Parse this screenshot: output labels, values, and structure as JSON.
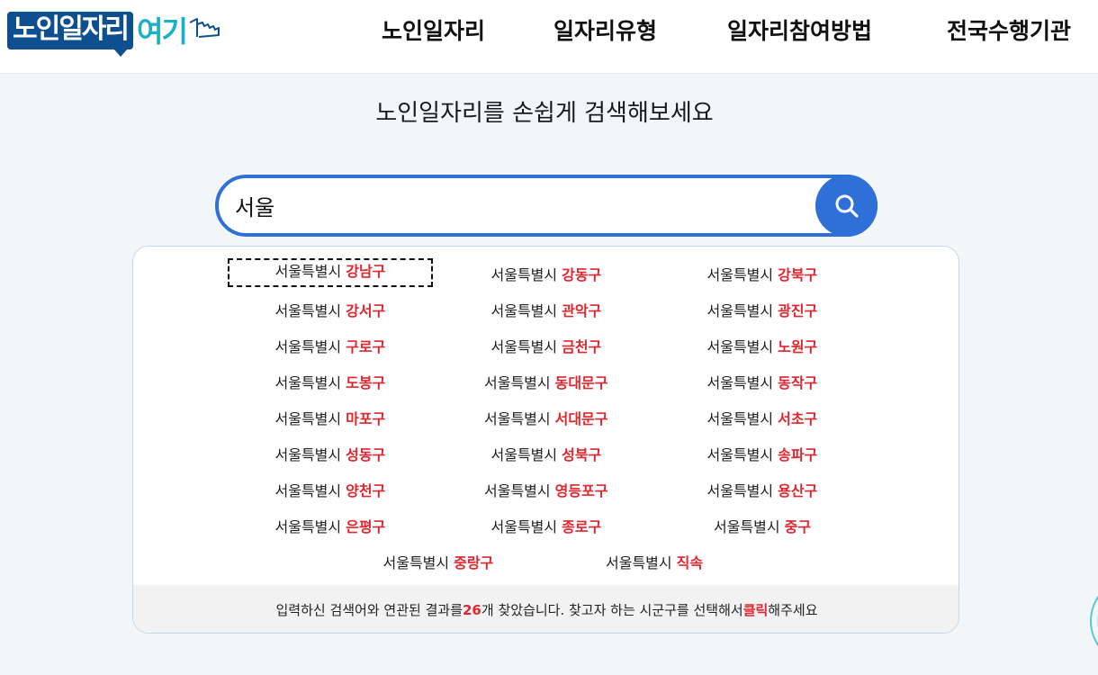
{
  "header": {
    "logo_main": "노인일자리",
    "logo_accent": "여기",
    "nav": [
      "노인일자리",
      "일자리유형",
      "일자리참여방법",
      "전국수행기관"
    ]
  },
  "subtitle": "노인일자리를 손쉽게 검색해보세요",
  "search": {
    "value": "서울"
  },
  "results": [
    {
      "city": "서울특별시",
      "district": "강남구"
    },
    {
      "city": "서울특별시",
      "district": "강동구"
    },
    {
      "city": "서울특별시",
      "district": "강북구"
    },
    {
      "city": "서울특별시",
      "district": "강서구"
    },
    {
      "city": "서울특별시",
      "district": "관악구"
    },
    {
      "city": "서울특별시",
      "district": "광진구"
    },
    {
      "city": "서울특별시",
      "district": "구로구"
    },
    {
      "city": "서울특별시",
      "district": "금천구"
    },
    {
      "city": "서울특별시",
      "district": "노원구"
    },
    {
      "city": "서울특별시",
      "district": "도봉구"
    },
    {
      "city": "서울특별시",
      "district": "동대문구"
    },
    {
      "city": "서울특별시",
      "district": "동작구"
    },
    {
      "city": "서울특별시",
      "district": "마포구"
    },
    {
      "city": "서울특별시",
      "district": "서대문구"
    },
    {
      "city": "서울특별시",
      "district": "서초구"
    },
    {
      "city": "서울특별시",
      "district": "성동구"
    },
    {
      "city": "서울특별시",
      "district": "성북구"
    },
    {
      "city": "서울특별시",
      "district": "송파구"
    },
    {
      "city": "서울특별시",
      "district": "양천구"
    },
    {
      "city": "서울특별시",
      "district": "영등포구"
    },
    {
      "city": "서울특별시",
      "district": "용산구"
    },
    {
      "city": "서울특별시",
      "district": "은평구"
    },
    {
      "city": "서울특별시",
      "district": "종로구"
    },
    {
      "city": "서울특별시",
      "district": "중구"
    },
    {
      "city": "서울특별시",
      "district": "중랑구"
    },
    {
      "city": "서울특별시",
      "district": "직속"
    }
  ],
  "footer": {
    "pre": "입력하신 검색어와 연관된 결과를 ",
    "count": "26",
    "mid": "개 찾았습니다. 찾고자 하는 시군구를 선택해서 ",
    "click": "클릭",
    "post": "해주세요"
  },
  "colors": {
    "accent_blue": "#2f6fd8",
    "highlight_red": "#e0262e",
    "logo_navy": "#0d4f8f",
    "logo_teal": "#1ab0c8"
  }
}
